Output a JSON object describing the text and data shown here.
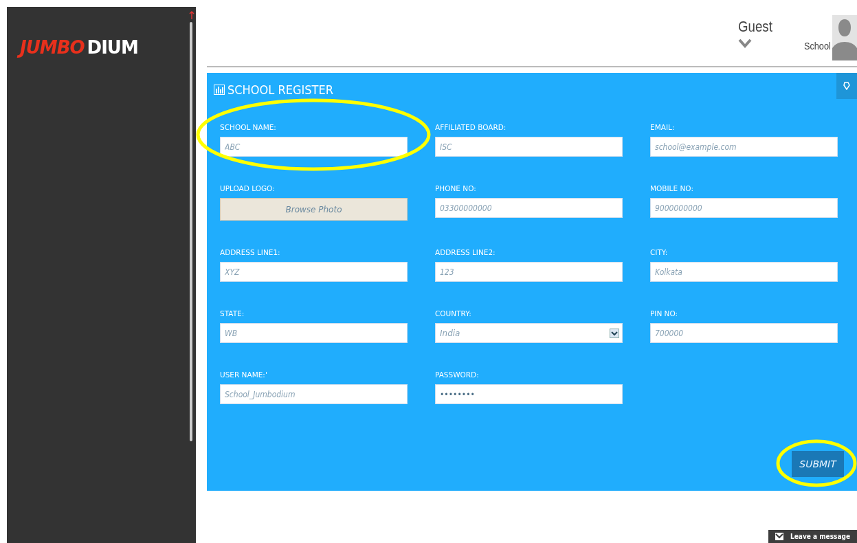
{
  "sidebar": {
    "logo": {
      "part_1": "JUMBO",
      "part_2": "DIUM"
    }
  },
  "header": {
    "user_name": "Guest",
    "role": "School"
  },
  "form": {
    "title": "SCHOOL REGISTER",
    "fields": [
      {
        "kind": "text",
        "label": "SCHOOL NAME:",
        "placeholder": "ABC",
        "highlighted": true
      },
      {
        "kind": "text",
        "label": "AFFILIATED BOARD:",
        "placeholder": "ISC",
        "highlighted": false
      },
      {
        "kind": "text",
        "label": "EMAIL:",
        "placeholder": "school@example.com",
        "highlighted": false
      },
      {
        "kind": "file",
        "label": "UPLOAD LOGO:",
        "button": "Browse Photo",
        "highlighted": false
      },
      {
        "kind": "text",
        "label": "PHONE NO:",
        "placeholder": "03300000000",
        "highlighted": false
      },
      {
        "kind": "text",
        "label": "MOBILE NO:",
        "placeholder": "9000000000",
        "highlighted": false
      },
      {
        "kind": "text",
        "label": "ADDRESS LINE1:",
        "placeholder": "XYZ",
        "highlighted": false
      },
      {
        "kind": "text",
        "label": "ADDRESS LINE2:",
        "placeholder": "123",
        "highlighted": false
      },
      {
        "kind": "text",
        "label": "CITY:",
        "placeholder": "Kolkata",
        "highlighted": false
      },
      {
        "kind": "text",
        "label": "STATE:",
        "placeholder": "WB",
        "highlighted": false
      },
      {
        "kind": "select",
        "label": "COUNTRY:",
        "value": "India",
        "highlighted": false
      },
      {
        "kind": "text",
        "label": "PIN NO:",
        "placeholder": "700000",
        "highlighted": false
      },
      {
        "kind": "text",
        "label": "USER NAME:'",
        "placeholder": "School_Jumbodium",
        "highlighted": false
      },
      {
        "kind": "password",
        "label": "PASSWORD:",
        "value": "••••••••",
        "highlighted": false
      }
    ],
    "submit": {
      "label": "SUBMIT",
      "highlighted": true
    }
  },
  "chat_badge": {
    "label": "Leave a message"
  }
}
